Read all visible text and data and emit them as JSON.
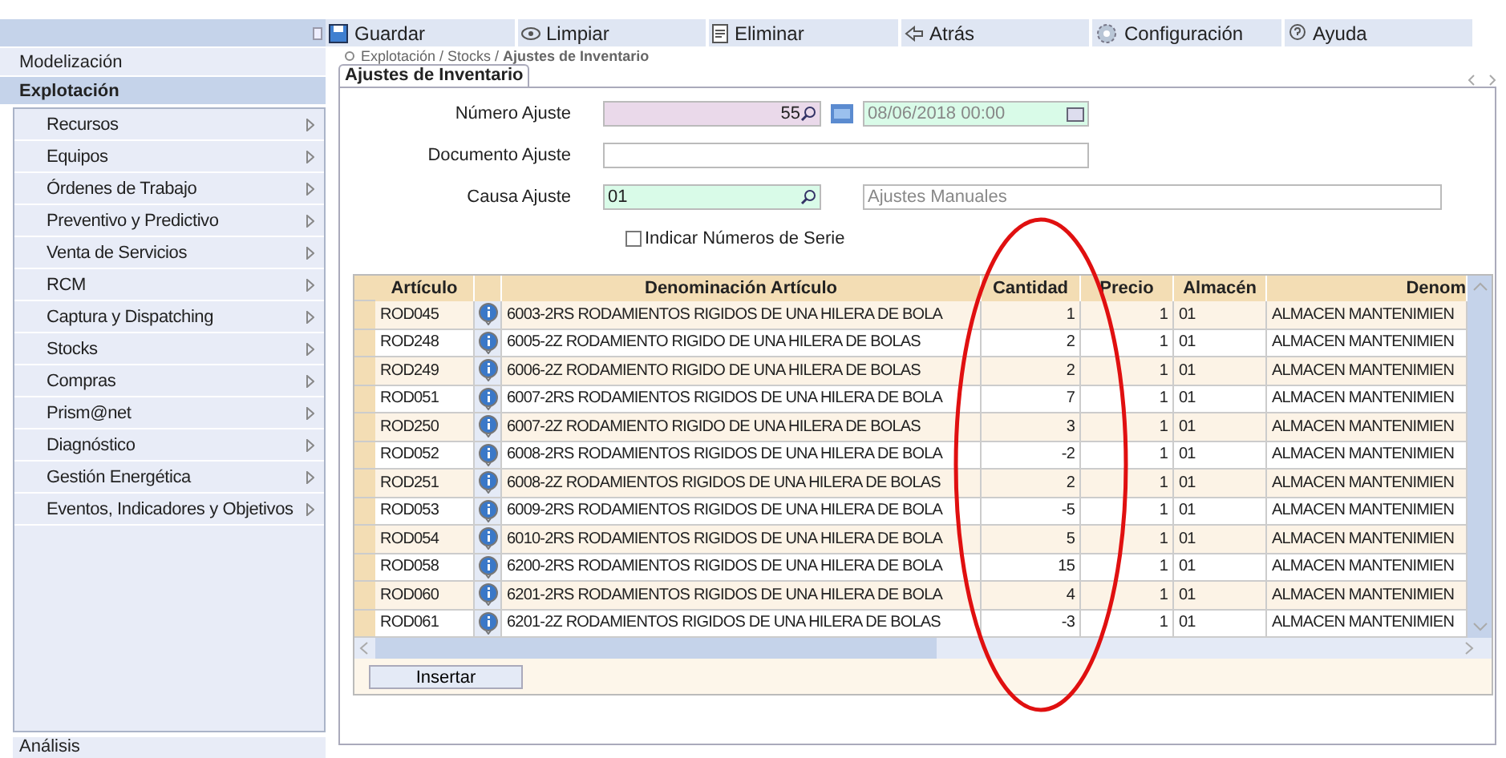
{
  "toolbar": [
    {
      "kind": "save",
      "label": "Guardar"
    },
    {
      "kind": "clear",
      "label": "Limpiar"
    },
    {
      "kind": "delete",
      "label": "Eliminar"
    },
    {
      "kind": "back",
      "label": "Atrás"
    },
    {
      "kind": "settings",
      "label": "Configuración"
    },
    {
      "kind": "help",
      "label": "Ayuda"
    }
  ],
  "sidebar": {
    "sections": [
      {
        "label": "Modelización",
        "selected": false
      },
      {
        "label": "Explotación",
        "selected": true
      }
    ],
    "items": [
      "Recursos",
      "Equipos",
      "Órdenes de Trabajo",
      "Preventivo y Predictivo",
      "Venta de Servicios",
      "RCM",
      "Captura y Dispatching",
      "Stocks",
      "Compras",
      "Prism@net",
      "Diagnóstico",
      "Gestión Energética",
      "Eventos, Indicadores y Objetivos"
    ],
    "footer": "Análisis"
  },
  "breadcrumb": {
    "path": "Explotación / Stocks / ",
    "current": "Ajustes de Inventario"
  },
  "tab": "Ajustes de Inventario",
  "form": {
    "numero": {
      "label": "Número Ajuste",
      "value": "55"
    },
    "fecha": "08/06/2018 00:00",
    "documento": {
      "label": "Documento Ajuste"
    },
    "causa": {
      "label": "Causa Ajuste",
      "value": "01",
      "description": "Ajustes Manuales"
    },
    "serie": {
      "label": "Indicar Números de Serie",
      "checked": false
    }
  },
  "table": {
    "columns": [
      "Artículo",
      "Denominación Artículo",
      "Cantidad",
      "Precio",
      "Almacén",
      "Denom"
    ],
    "rows": [
      [
        "ROD045",
        "6003-2RS RODAMIENTOS RIGIDOS DE UNA HILERA DE BOLA",
        "1",
        "1",
        "01",
        "ALMACEN MANTENIMIEN"
      ],
      [
        "ROD248",
        "6005-2Z RODAMIENTO RIGIDO DE UNA HILERA DE BOLAS",
        "2",
        "1",
        "01",
        "ALMACEN MANTENIMIEN"
      ],
      [
        "ROD249",
        "6006-2Z RODAMIENTO RIGIDO DE UNA HILERA DE BOLAS",
        "2",
        "1",
        "01",
        "ALMACEN MANTENIMIEN"
      ],
      [
        "ROD051",
        "6007-2RS  RODAMIENTOS RIGIDOS DE UNA HILERA DE BOLA",
        "7",
        "1",
        "01",
        "ALMACEN MANTENIMIEN"
      ],
      [
        "ROD250",
        "6007-2Z RODAMIENTO RIGIDO DE UNA HILERA DE BOLAS",
        "3",
        "1",
        "01",
        "ALMACEN MANTENIMIEN"
      ],
      [
        "ROD052",
        "6008-2RS  RODAMIENTOS RIGIDOS DE UNA HILERA DE BOLA",
        "-2",
        "1",
        "01",
        "ALMACEN MANTENIMIEN"
      ],
      [
        "ROD251",
        "6008-2Z RODAMIENTOS RIGIDOS DE UNA HILERA DE BOLAS",
        "2",
        "1",
        "01",
        "ALMACEN MANTENIMIEN"
      ],
      [
        "ROD053",
        "6009-2RS  RODAMIENTOS RIGIDOS DE UNA HILERA DE BOLA",
        "-5",
        "1",
        "01",
        "ALMACEN MANTENIMIEN"
      ],
      [
        "ROD054",
        "6010-2RS  RODAMIENTOS RIGIDOS DE UNA HILERA DE BOLA",
        "5",
        "1",
        "01",
        "ALMACEN MANTENIMIEN"
      ],
      [
        "ROD058",
        "6200-2RS  RODAMIENTOS RIGIDOS DE UNA HILERA DE BOLA",
        "15",
        "1",
        "01",
        "ALMACEN MANTENIMIEN"
      ],
      [
        "ROD060",
        "6201-2RS  RODAMIENTOS RIGIDOS DE UNA HILERA DE BOLA",
        "4",
        "1",
        "01",
        "ALMACEN MANTENIMIEN"
      ],
      [
        "ROD061",
        "6201-2Z  RODAMIENTOS RIGIDOS DE UNA HILERA DE BOLAS",
        "-3",
        "1",
        "01",
        "ALMACEN MANTENIMIEN"
      ]
    ],
    "insert_button": "Insertar"
  }
}
